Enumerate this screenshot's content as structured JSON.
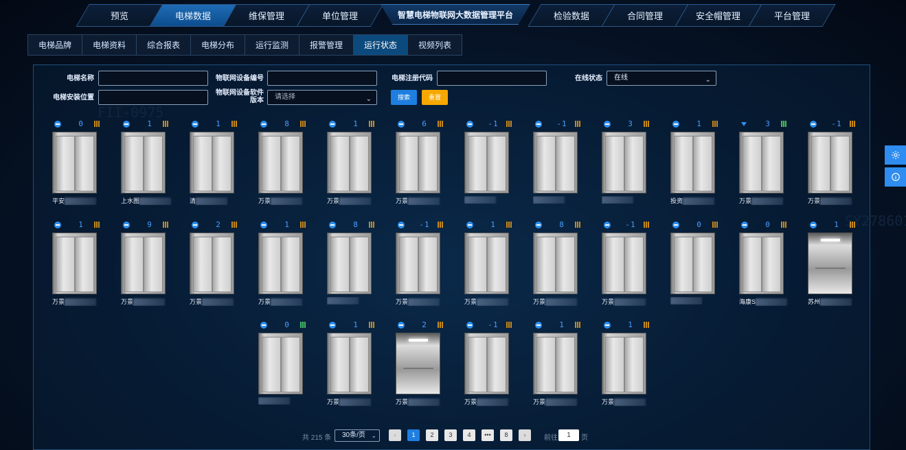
{
  "nav": {
    "tabs": [
      {
        "label": "预览",
        "active": false
      },
      {
        "label": "电梯数据",
        "active": true
      },
      {
        "label": "维保管理",
        "active": false
      },
      {
        "label": "单位管理",
        "active": false
      }
    ],
    "center_title": "智慧电梯物联网大数据管理平台",
    "tabs_right": [
      {
        "label": "检验数据"
      },
      {
        "label": "合同管理"
      },
      {
        "label": "安全帽管理"
      },
      {
        "label": "平台管理"
      }
    ]
  },
  "subtabs": [
    {
      "label": "电梯品牌"
    },
    {
      "label": "电梯资料"
    },
    {
      "label": "综合报表"
    },
    {
      "label": "电梯分布"
    },
    {
      "label": "运行监测"
    },
    {
      "label": "报警管理"
    },
    {
      "label": "运行状态",
      "active": true
    },
    {
      "label": "视频列表"
    }
  ],
  "filters": {
    "elevator_name_label": "电梯名称",
    "elevator_name_value": "",
    "iot_device_no_label": "物联网设备编号",
    "iot_device_no_value": "",
    "register_code_label": "电梯注册代码",
    "register_code_value": "",
    "online_status_label": "在线状态",
    "online_status_value": "在线",
    "install_location_label": "电梯安装位置",
    "install_location_value": "",
    "software_version_label_1": "物联网设备软件",
    "software_version_label_2": "版本",
    "software_version_placeholder": "请选择",
    "search_button": "搜索",
    "reset_button": "重置"
  },
  "elevators": [
    {
      "floor": "0",
      "dir": "stop",
      "door": "closed",
      "name": "平安"
    },
    {
      "floor": "1",
      "dir": "stop",
      "door": "closed",
      "name": "上水图"
    },
    {
      "floor": "1",
      "dir": "stop",
      "door": "closed",
      "name": "清"
    },
    {
      "floor": "8",
      "dir": "stop",
      "door": "closed",
      "name": "万景"
    },
    {
      "floor": "1",
      "dir": "stop",
      "door": "closed",
      "name": "万景"
    },
    {
      "floor": "6",
      "dir": "stop",
      "door": "closed",
      "name": "万景"
    },
    {
      "floor": "-1",
      "dir": "stop",
      "door": "closed",
      "name": ""
    },
    {
      "floor": "-1",
      "dir": "stop",
      "door": "closed",
      "name": ""
    },
    {
      "floor": "3",
      "dir": "stop",
      "door": "closed",
      "name": ""
    },
    {
      "floor": "1",
      "dir": "stop",
      "door": "closed",
      "name": "投资"
    },
    {
      "floor": "3",
      "dir": "down",
      "door": "open",
      "name": "万景"
    },
    {
      "floor": "-1",
      "dir": "stop",
      "door": "closed",
      "name": "万景"
    },
    {
      "floor": "1",
      "dir": "stop",
      "door": "closed",
      "name": "万景"
    },
    {
      "floor": "9",
      "dir": "stop",
      "door": "closed",
      "name": "万景"
    },
    {
      "floor": "2",
      "dir": "stop",
      "door": "closed",
      "name": "万景"
    },
    {
      "floor": "1",
      "dir": "stop",
      "door": "closed",
      "name": "万景"
    },
    {
      "floor": "8",
      "dir": "stop",
      "door": "closed",
      "name": ""
    },
    {
      "floor": "-1",
      "dir": "stop",
      "door": "closed",
      "name": "万景"
    },
    {
      "floor": "1",
      "dir": "stop",
      "door": "closed",
      "name": "万景"
    },
    {
      "floor": "8",
      "dir": "stop",
      "door": "closed",
      "name": "万景"
    },
    {
      "floor": "-1",
      "dir": "stop",
      "door": "closed",
      "name": "万景"
    },
    {
      "floor": "0",
      "dir": "stop",
      "door": "closed",
      "name": ""
    },
    {
      "floor": "0",
      "dir": "stop",
      "door": "closed",
      "name": "海康S"
    },
    {
      "floor": "1",
      "dir": "stop",
      "door": "closed",
      "name": "苏州",
      "open": true
    },
    {
      "floor": "0",
      "dir": "stop",
      "door": "open",
      "name": ""
    },
    {
      "floor": "1",
      "dir": "stop",
      "door": "closed",
      "name": "万景"
    },
    {
      "floor": "2",
      "dir": "stop",
      "door": "closed",
      "name": "万景",
      "open": true
    },
    {
      "floor": "-1",
      "dir": "stop",
      "door": "closed",
      "name": "万景"
    },
    {
      "floor": "1",
      "dir": "stop",
      "door": "closed",
      "name": "万景"
    },
    {
      "floor": "1",
      "dir": "stop",
      "door": "closed",
      "name": "万景"
    }
  ],
  "pagination": {
    "total": "共 215 条",
    "page_size": "30条/页",
    "pages": [
      "1",
      "2",
      "3",
      "4",
      "•••",
      "8"
    ],
    "goto_label": "前往",
    "goto_value": "1",
    "page_unit": "页"
  },
  "colors": {
    "accent": "#1f7fe0",
    "reset": "#f6a800",
    "floor": "#4b9dff"
  }
}
